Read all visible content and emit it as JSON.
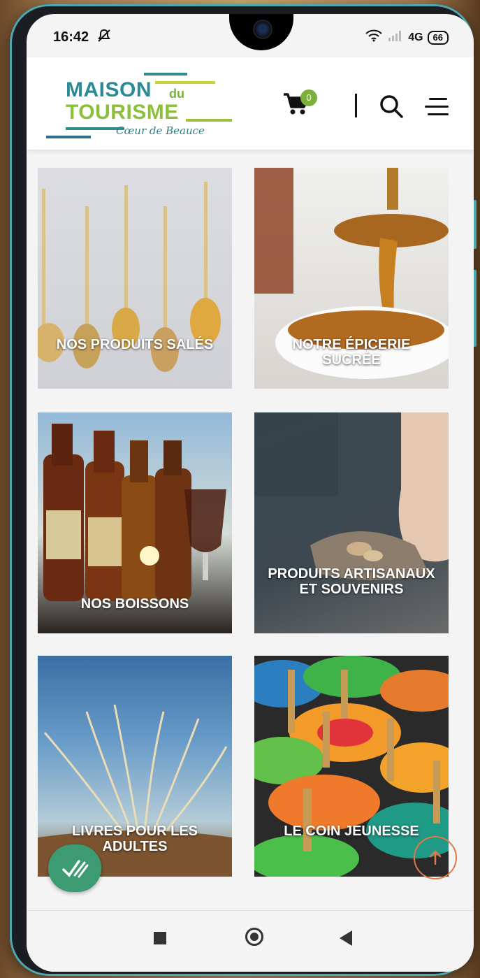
{
  "status": {
    "time": "16:42",
    "network": "4G",
    "battery": "66"
  },
  "header": {
    "logo": {
      "line1": "MAISON",
      "du": "du",
      "line2": "TOURISME",
      "tagline": "Cœur de Beauce"
    },
    "cart_count": "0"
  },
  "tiles": [
    {
      "label": "NOS PRODUITS SALÉS"
    },
    {
      "label": "NOTRE ÉPICERIE SUCRÉE"
    },
    {
      "label": "NOS BOISSONS"
    },
    {
      "label": "PRODUITS ARTISANAUX ET SOUVENIRS"
    },
    {
      "label": "LIVRES POUR LES ADULTES"
    },
    {
      "label": "LE COIN JEUNESSE"
    }
  ],
  "colors": {
    "brand_teal": "#2a8a96",
    "brand_green": "#8cbf3a",
    "fab_green": "#3d9b74",
    "scroll_orange": "#e07a46"
  }
}
